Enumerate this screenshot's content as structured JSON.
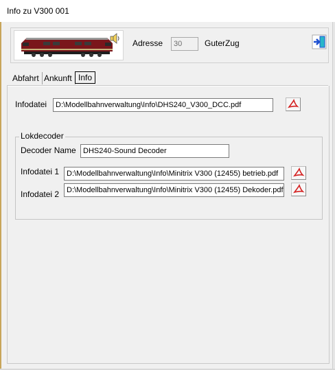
{
  "window": {
    "title": "Info zu V300 001"
  },
  "header": {
    "adresse_label": "Adresse",
    "adresse_value": "30",
    "zug_label": "GuterZug"
  },
  "tabs": [
    {
      "label": "Abfahrt"
    },
    {
      "label": "Ankunft"
    },
    {
      "label": "Info",
      "active": true
    }
  ],
  "info": {
    "infodatei_label": "Infodatei",
    "infodatei_value": "D:\\Modellbahnverwaltung\\Info\\DHS240_V300_DCC.pdf"
  },
  "lokdecoder": {
    "title": "Lokdecoder",
    "decoder_name_label": "Decoder Name",
    "decoder_name_value": "DHS240-Sound Decoder",
    "infodatei1_label": "Infodatei 1",
    "infodatei1_value": "D:\\Modellbahnverwaltung\\Info\\Minitrix V300 (12455) betrieb.pdf",
    "infodatei2_label": "Infodatei 2",
    "infodatei2_value": "D:\\Modellbahnverwaltung\\Info\\Minitrix V300 (12455) Dekoder.pdf"
  },
  "icons": {
    "pdf": "pdf-icon",
    "exit": "exit-door-icon",
    "speaker": "speaker-icon",
    "locomotive": "locomotive-image"
  },
  "colors": {
    "loco_body": "#8b1a1f",
    "loco_roof": "#9a9a9a",
    "pdf_red": "#d42020",
    "exit_blue": "#1d4fd1",
    "exit_teal": "#29b6c9"
  }
}
